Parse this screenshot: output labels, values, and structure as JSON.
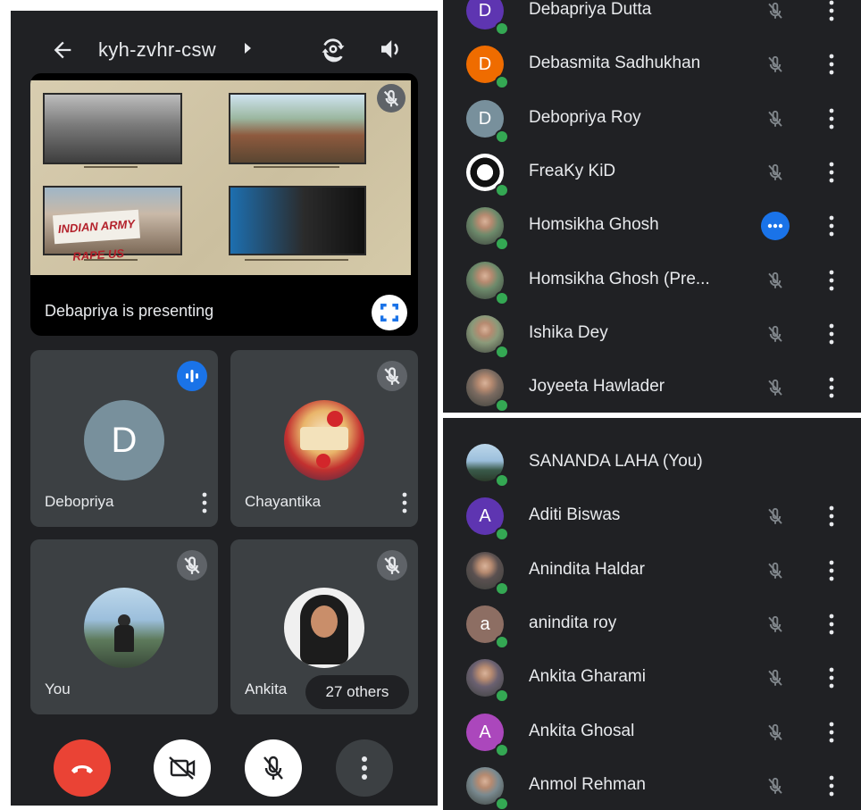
{
  "meeting": {
    "code": "kyh-zvhr-csw"
  },
  "presentation": {
    "label": "Debapriya is presenting",
    "slide_banner": "INDIAN ARMY RAPE US"
  },
  "tiles": [
    {
      "name": "Debopriya",
      "initial": "D",
      "avatar_color": "#78909c",
      "status": "speaking"
    },
    {
      "name": "Chayantika",
      "status": "muted"
    },
    {
      "name": "You",
      "status": "muted"
    },
    {
      "name": "Ankita",
      "status": "muted"
    }
  ],
  "others": {
    "label": "27 others"
  },
  "colors": {
    "end_call": "#ea4335",
    "accent_blue": "#1a73e8",
    "presence": "#34a853",
    "panel": "#202124",
    "tile": "#3c4043"
  },
  "participants_top": [
    {
      "name": "Debapriya Dutta",
      "initial": "D",
      "color": "#5e35b1"
    },
    {
      "name": "Debasmita Sadhukhan",
      "initial": "D",
      "color": "#ef6c00"
    },
    {
      "name": "Debopriya Roy",
      "initial": "D",
      "color": "#78909c"
    },
    {
      "name": "FreaKy KiD",
      "initial": "",
      "color": "#ffffff",
      "photo": "wolf"
    },
    {
      "name": "Homsikha Ghosh",
      "initial": "",
      "color": "#6d8a6b",
      "photo": "person",
      "speaking": true
    },
    {
      "name": "Homsikha Ghosh (Pre...",
      "initial": "",
      "color": "#6d8a6b",
      "photo": "person"
    },
    {
      "name": "Ishika Dey",
      "initial": "",
      "color": "#8a9a7a",
      "photo": "person"
    },
    {
      "name": "Joyeeta Hawlader",
      "initial": "",
      "color": "#7a6a60",
      "photo": "person"
    }
  ],
  "participants_bottom": [
    {
      "name": "SANANDA LAHA (You)",
      "initial": "",
      "color": "#5a7a9a",
      "photo": "landscape",
      "self": true
    },
    {
      "name": "Aditi Biswas",
      "initial": "A",
      "color": "#5e35b1"
    },
    {
      "name": "Anindita Haldar",
      "initial": "",
      "color": "#5a5050",
      "photo": "person"
    },
    {
      "name": "anindita roy",
      "initial": "a",
      "color": "#8d6e63"
    },
    {
      "name": "Ankita Gharami",
      "initial": "",
      "color": "#6a6070",
      "photo": "person"
    },
    {
      "name": "Ankita Ghosal",
      "initial": "A",
      "color": "#ab47bc"
    },
    {
      "name": "Anmol Rehman",
      "initial": "",
      "color": "#7a8a90",
      "photo": "person"
    }
  ]
}
